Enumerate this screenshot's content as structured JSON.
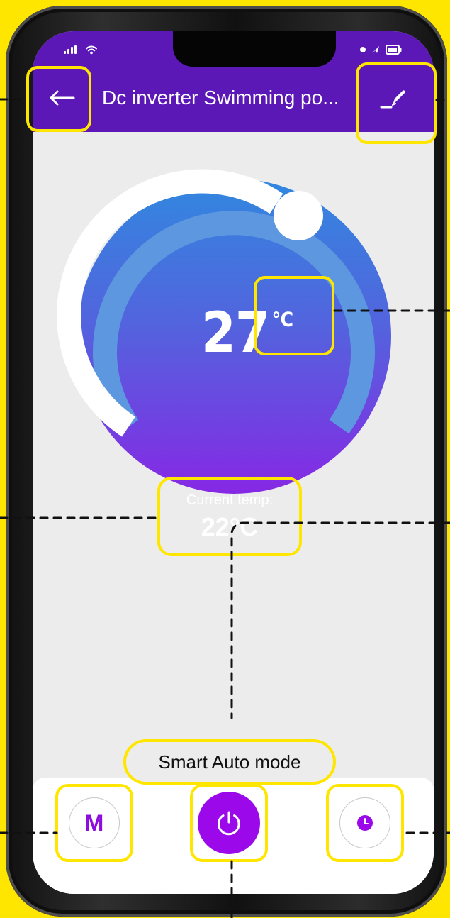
{
  "header": {
    "title": "Dc inverter Swimming po..."
  },
  "thermostat": {
    "set_temperature": "27",
    "set_temperature_unit": "℃",
    "current_label": "Current temp:",
    "current_value": "22°C"
  },
  "mode": {
    "label": "Smart Auto mode"
  },
  "buttons": {
    "mode_letter": "M"
  },
  "icons": {
    "back": "back-arrow-icon",
    "edit": "pencil-icon",
    "power": "power-icon",
    "timer": "clock-icon",
    "signal": "signal-icon",
    "wifi": "wifi-icon",
    "location": "location-arrow-icon",
    "battery": "battery-icon"
  },
  "colors": {
    "accent_yellow": "#FFE600",
    "header_purple": "#5B18B6",
    "dial_top_blue": "#3188DF",
    "dial_bottom_purple": "#8628E4",
    "button_purple": "#9B09EA"
  }
}
